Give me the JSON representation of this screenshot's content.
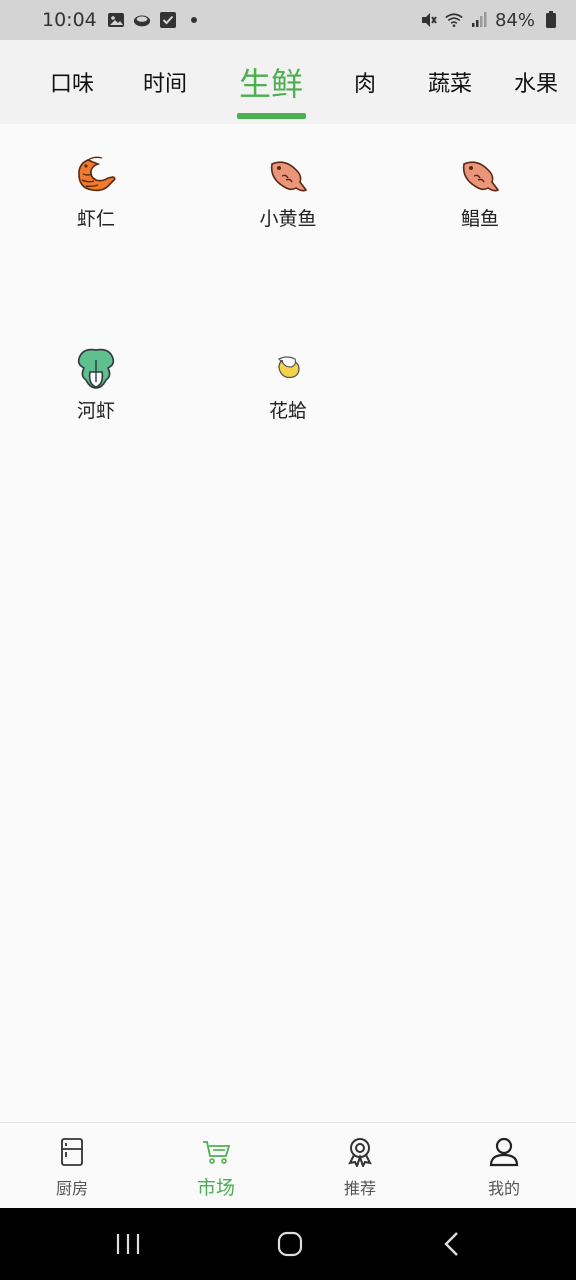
{
  "status_bar": {
    "time": "10:04",
    "battery": "84%",
    "icons": [
      "gallery-icon",
      "cloud-icon",
      "check-icon",
      "dot-icon",
      "mute-icon",
      "wifi-icon",
      "signal-icon",
      "battery-icon"
    ]
  },
  "tabs": [
    {
      "label": "口味",
      "active": false
    },
    {
      "label": "时间",
      "active": false
    },
    {
      "label": "生鲜",
      "active": true
    },
    {
      "label": "肉",
      "active": false
    },
    {
      "label": "蔬菜",
      "active": false
    },
    {
      "label": "水果",
      "active": false
    }
  ],
  "items": [
    {
      "label": "虾仁",
      "icon": "shrimp-icon"
    },
    {
      "label": "小黄鱼",
      "icon": "fish-icon"
    },
    {
      "label": "鲳鱼",
      "icon": "fish-icon"
    },
    {
      "label": "河虾",
      "icon": "bok-choy-icon"
    },
    {
      "label": "花蛤",
      "icon": "small-shrimp-icon"
    }
  ],
  "bottom_nav": [
    {
      "label": "厨房",
      "icon": "fridge-icon",
      "active": false
    },
    {
      "label": "市场",
      "icon": "cart-icon",
      "active": true
    },
    {
      "label": "推荐",
      "icon": "award-icon",
      "active": false
    },
    {
      "label": "我的",
      "icon": "user-icon",
      "active": false
    }
  ],
  "colors": {
    "accent": "#4caf50",
    "status_bar_bg": "#d4d4d4",
    "tab_bg": "#f2f2f2",
    "page_bg": "#fafafa",
    "system_nav_bg": "#000000"
  },
  "system_nav": [
    "recents-icon",
    "home-icon",
    "back-icon"
  ]
}
